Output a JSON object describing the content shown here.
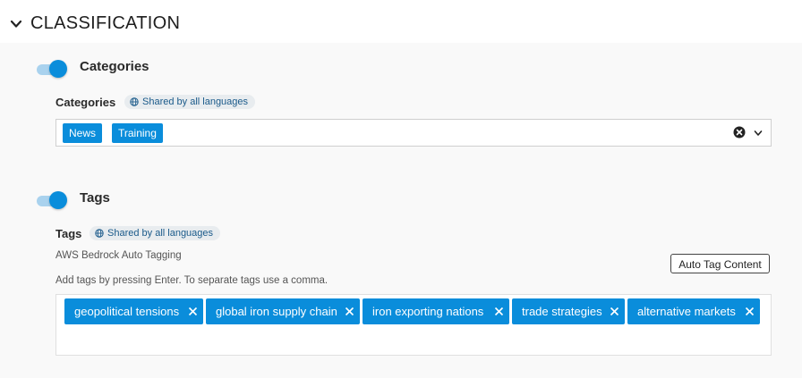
{
  "section": {
    "title": "CLASSIFICATION"
  },
  "categories": {
    "toggle_on": true,
    "heading": "Categories",
    "field_label": "Categories",
    "shared_badge": "Shared by all languages",
    "selected": [
      "News",
      "Training"
    ]
  },
  "tags": {
    "toggle_on": true,
    "heading": "Tags",
    "field_label": "Tags",
    "shared_badge": "Shared by all languages",
    "auto_tagging_label": "AWS Bedrock Auto Tagging",
    "auto_tag_button": "Auto Tag Content",
    "helper_text": "Add tags by pressing Enter. To separate tags use a comma.",
    "items": [
      "geopolitical tensions",
      "global iron supply chain",
      "iron exporting nations",
      "trade strategies",
      "alternative markets"
    ]
  },
  "colors": {
    "accent": "#0a8ddb",
    "toggle_track": "#a9d2ee",
    "badge_bg": "#e8ecef",
    "badge_text": "#1a5a8a",
    "panel_bg": "#f9f9f9"
  },
  "icons": {
    "section_toggle": "chevron-down-icon",
    "shared": "globe-icon",
    "clear": "clear-circle-icon",
    "dropdown": "chevron-down-icon",
    "remove_tag": "close-icon"
  }
}
